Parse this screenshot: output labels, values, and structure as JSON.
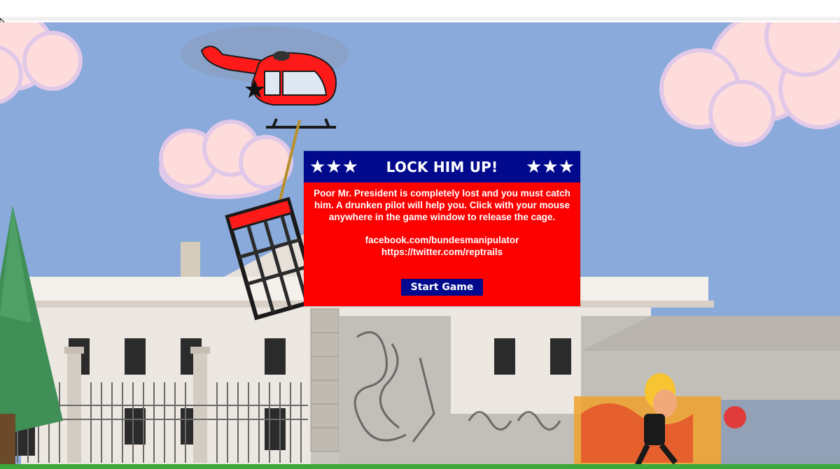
{
  "dialog": {
    "title": "LOCK HIM UP!",
    "stars_left": "★★★",
    "stars_right": "★★★",
    "instructions": "Poor Mr. President is completely lost and you must catch him. A drunken pilot will help you. Click with your mouse anywhere in the game window to release the cage.",
    "facebook": "facebook.com/bundesmanipulator",
    "twitter": "https://twitter.com/reptrails",
    "start_label": "Start Game"
  },
  "colors": {
    "sky": "#8aaadb",
    "dialog_red": "#fd0000",
    "dialog_blue": "#010a8c",
    "helicopter": "#ff1a1a",
    "cloud": "#ffdcdc",
    "tree": "#3f8f56",
    "grass": "#3da83a"
  },
  "icons": {
    "cursor": "mouse-pointer-icon",
    "star": "star-icon"
  }
}
